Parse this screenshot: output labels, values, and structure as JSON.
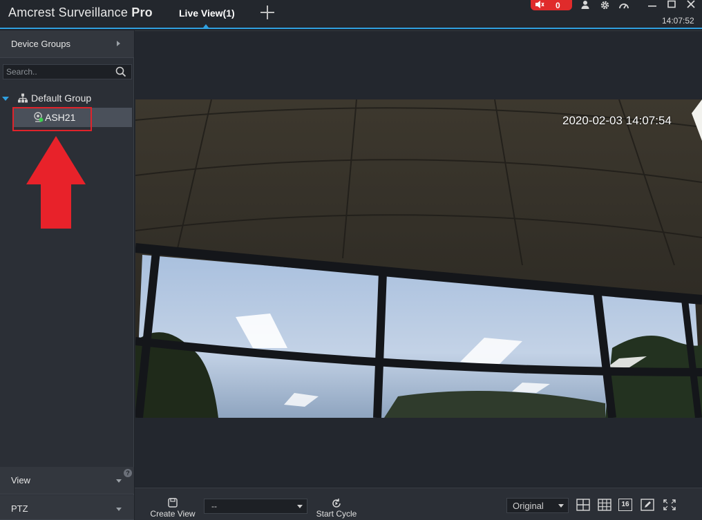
{
  "titlebar": {
    "app_name": "Amcrest Surveillance",
    "app_name_bold": "Pro",
    "tab_label": "Live View(1)",
    "alarm_count": "0",
    "clock": "14:07:52"
  },
  "sidebar": {
    "device_groups_label": "Device Groups",
    "search_placeholder": "Search..",
    "group_label": "Default Group",
    "device_label": "ASH21",
    "view_label": "View",
    "ptz_label": "PTZ",
    "help_badge": "?"
  },
  "video": {
    "timestamp": "2020-02-03 14:07:54"
  },
  "bottombar": {
    "create_view_label": "Create View",
    "view_select_value": "--",
    "start_cycle_label": "Start Cycle",
    "stream_value": "Original",
    "layout16_label": "16"
  },
  "colors": {
    "accent": "#2fa0e0",
    "alarm": "#e02b2b",
    "highlight_box": "#e0232b",
    "online_dot": "#3ccf4e"
  }
}
